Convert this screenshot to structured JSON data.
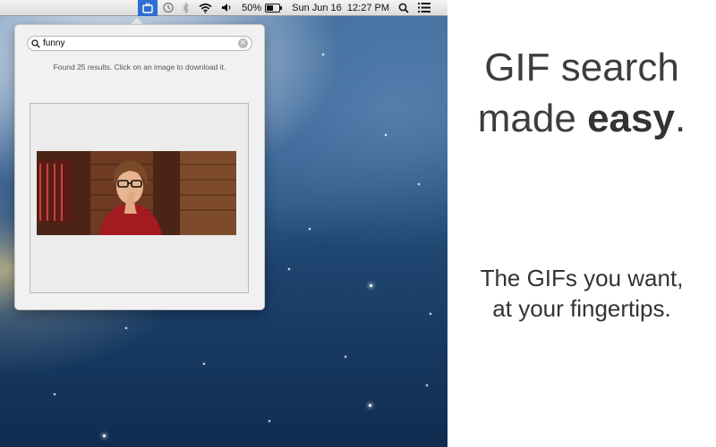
{
  "menubar": {
    "battery_percent": "50%",
    "datetime": "Sun Jun 16  12:27 PM",
    "icons": [
      "gif-app-icon",
      "time-machine-icon",
      "bluetooth-icon",
      "wifi-icon",
      "volume-icon",
      "battery-icon",
      "spotlight-icon",
      "notification-center-icon"
    ],
    "active_color": "#2f6ed3"
  },
  "popover": {
    "search": {
      "value": "funny"
    },
    "results_text": "Found 25 results. Click on an image to download it."
  },
  "marketing": {
    "headline_line1": "GIF search",
    "headline_line2_prefix": "made ",
    "headline_line2_bold": "easy",
    "headline_line2_suffix": ".",
    "sub_line1": "The GIFs you want,",
    "sub_line2": "at your fingertips."
  }
}
